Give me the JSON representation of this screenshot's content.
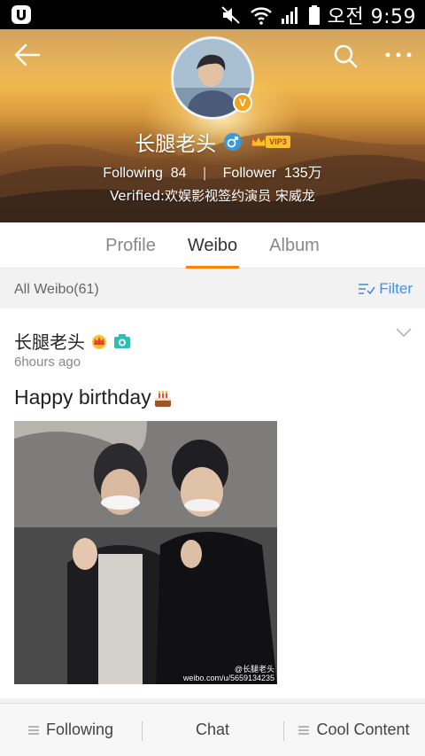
{
  "status_bar": {
    "time": "오전 9:59"
  },
  "profile": {
    "name": "长腿老头",
    "vip_label": "VIP3",
    "following_label": "Following",
    "following_count": "84",
    "follower_label": "Follower",
    "follower_count": "135万",
    "verified_text": "Verified:欢娱影视签约演员 宋威龙",
    "badge_letter": "V"
  },
  "tabs": [
    {
      "label": "Profile",
      "active": false
    },
    {
      "label": "Weibo",
      "active": true
    },
    {
      "label": "Album",
      "active": false
    }
  ],
  "list_header": {
    "all_weibo": "All Weibo(61)",
    "filter_label": "Filter"
  },
  "post": {
    "author": "长腿老头",
    "time": "6hours ago",
    "text": "Happy birthday",
    "watermark_line1": "@长腿老头",
    "watermark_line2": "weibo.com/u/5659134235"
  },
  "bottom_bar": {
    "following": "Following",
    "chat": "Chat",
    "cool_content": "Cool Content"
  },
  "colors": {
    "accent": "#ff8200",
    "link": "#4a90d9"
  }
}
